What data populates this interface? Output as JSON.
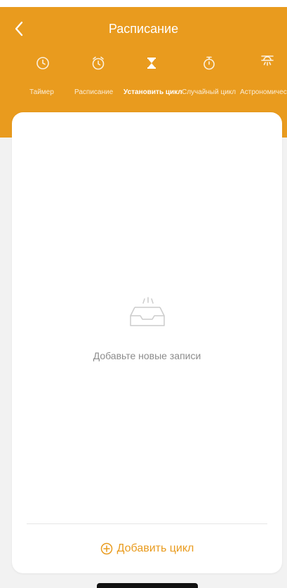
{
  "header": {
    "title": "Расписание",
    "background": "#e99b1e",
    "back_icon": "chevron-left-icon"
  },
  "tabs": [
    {
      "label": "Таймер",
      "icon": "clock-icon",
      "active": false
    },
    {
      "label": "Расписание",
      "icon": "alarm-clock-icon",
      "active": false
    },
    {
      "label": "Установить цикл",
      "icon": "hourglass-icon",
      "active": true
    },
    {
      "label": "Случайный цикл",
      "icon": "stopwatch-icon",
      "active": false
    },
    {
      "label": "Астрономичес",
      "icon": "sun-horizon-icon",
      "active": false
    }
  ],
  "empty_state": {
    "icon": "empty-tray-icon",
    "text": "Добавьте новые записи"
  },
  "footer": {
    "add_label": "Добавить цикл",
    "add_icon": "plus-circle-icon",
    "accent": "#e99b1e"
  }
}
